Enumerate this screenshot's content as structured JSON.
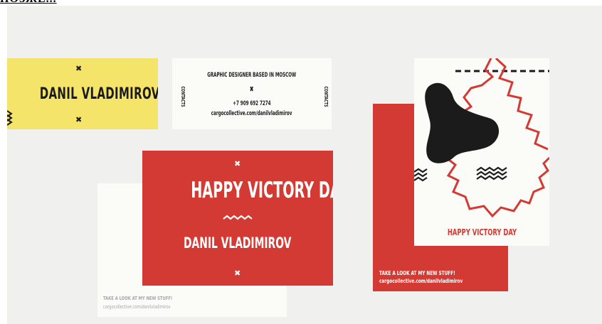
{
  "top_link": "ПОЗЖЕ...",
  "yellow_card": {
    "name": "DANIL VLADIMIROV"
  },
  "contacts_card": {
    "line1": "GRAPHIC DESIGNER BASED IN MOSCOW",
    "phone": "+7 909 692 7274",
    "site": "cargocollective.com/danilvladimirov",
    "side_left": "CONTACTS",
    "side_right": "CONTACTS"
  },
  "red_card": {
    "title": "HAPPY VICTORY DAY",
    "name": "DANIL VLADIMIROV"
  },
  "back_card": {
    "line1": "TAKE A LOOK AT MY NEW STUFF!",
    "line2": "cargocollective.com/danilvladimirov"
  },
  "tall_red_card": {
    "line1": "TAKE A LOOK AT MY NEW STUFF!",
    "line2": "cargocollective.com/danilvladimirov"
  },
  "poster": {
    "title": "HAPPY VICTORY DAY"
  },
  "colors": {
    "background": "#f0f0ef",
    "yellow": "#f5e46a",
    "red": "#d33a33",
    "paper": "#fbfbf8",
    "ink": "#1b1b1b"
  }
}
